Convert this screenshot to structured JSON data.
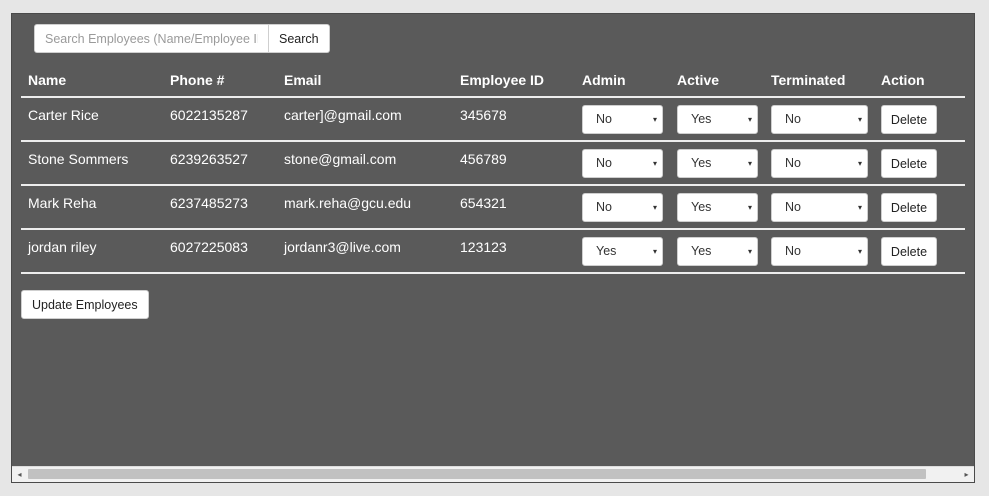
{
  "search": {
    "placeholder": "Search Employees (Name/Employee ID)",
    "button_label": "Search"
  },
  "table": {
    "headers": [
      "Name",
      "Phone #",
      "Email",
      "Employee ID",
      "Admin",
      "Active",
      "Terminated",
      "Action"
    ],
    "rows": [
      {
        "name": "Carter Rice",
        "phone": "6022135287",
        "email": "carter]@gmail.com",
        "employee_id": "345678",
        "admin": "No",
        "active": "Yes",
        "terminated": "No",
        "action": "Delete"
      },
      {
        "name": "Stone Sommers",
        "phone": "6239263527",
        "email": "stone@gmail.com",
        "employee_id": "456789",
        "admin": "No",
        "active": "Yes",
        "terminated": "No",
        "action": "Delete"
      },
      {
        "name": "Mark Reha",
        "phone": "6237485273",
        "email": "mark.reha@gcu.edu",
        "employee_id": "654321",
        "admin": "No",
        "active": "Yes",
        "terminated": "No",
        "action": "Delete"
      },
      {
        "name": "jordan riley",
        "phone": "6027225083",
        "email": "jordanr3@live.com",
        "employee_id": "123123",
        "admin": "Yes",
        "active": "Yes",
        "terminated": "No",
        "action": "Delete"
      }
    ]
  },
  "update_button_label": "Update Employees",
  "icons": {
    "select_caret": "▾",
    "scroll_left": "◂",
    "scroll_right": "▸"
  },
  "colors": {
    "panel_background": "#5a5a5a",
    "page_background": "#e6e6e6",
    "text": "#ffffff"
  }
}
